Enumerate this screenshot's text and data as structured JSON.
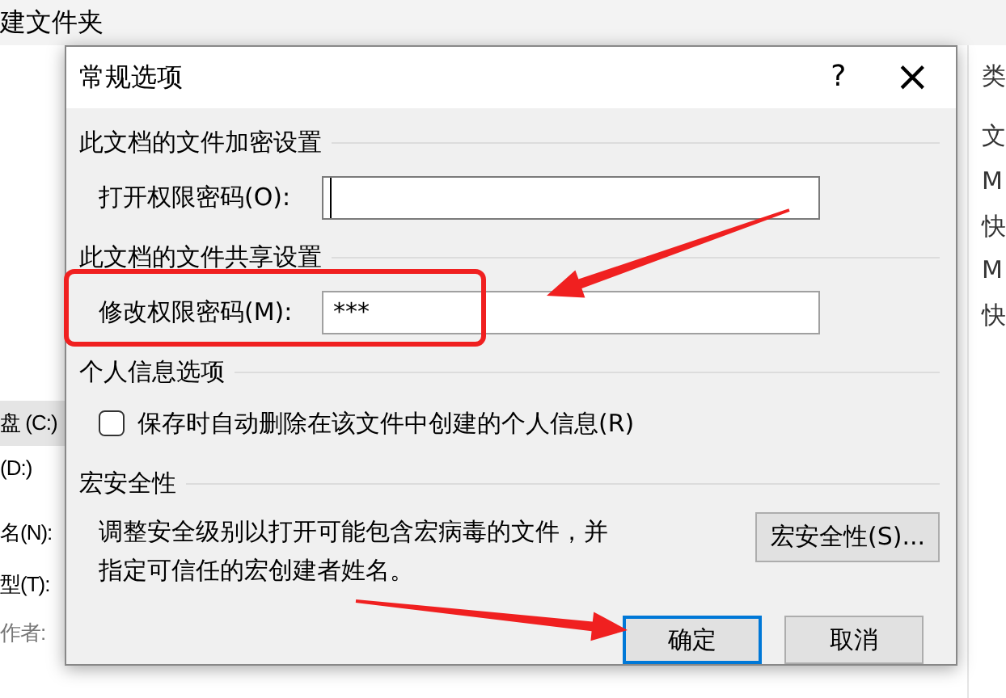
{
  "background_window": {
    "toolbar_text": "建文件夹",
    "right_pane": {
      "header": "类",
      "items": [
        "文",
        "M",
        "快",
        "M",
        "快"
      ]
    },
    "left_pane": {
      "drives": [
        {
          "label": "盘 (C:)",
          "selected": true
        },
        {
          "label": "(D:)",
          "selected": false
        }
      ],
      "fields": [
        "名(N):",
        "型(T):"
      ],
      "author_label": "作者:"
    }
  },
  "dialog": {
    "title": "常规选项",
    "help_button": "?",
    "close_button": "×",
    "sections": [
      {
        "kind": "password",
        "heading": "此文档的文件加密设置",
        "label": "打开权限密码(O):",
        "focused": true
      },
      {
        "kind": "password",
        "heading": "此文档的文件共享设置",
        "label": "修改权限密码(M):",
        "value": "***",
        "focused": false
      },
      {
        "kind": "checkbox",
        "heading": "个人信息选项",
        "label": "保存时自动删除在该文件中创建的个人信息(R)",
        "checked": false
      },
      {
        "kind": "macro",
        "heading": "宏安全性",
        "text": "调整安全级别以打开可能包含宏病毒的文件，并指定可信任的宏创建者姓名。",
        "button": "宏安全性(S)..."
      }
    ],
    "buttons": [
      {
        "label": "确定",
        "default": true
      },
      {
        "label": "取消",
        "default": false
      }
    ]
  },
  "annotations": [
    {
      "kind": "box"
    },
    {
      "kind": "arrow"
    },
    {
      "kind": "arrow"
    }
  ]
}
